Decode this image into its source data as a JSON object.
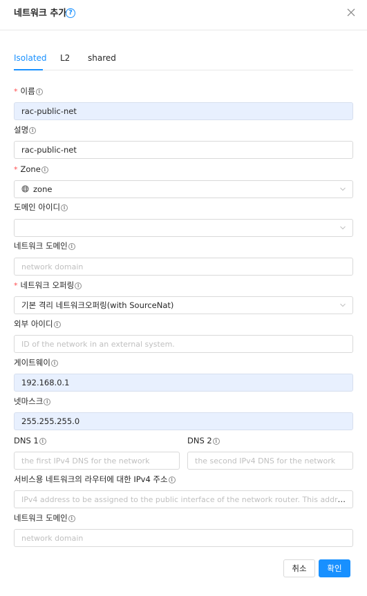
{
  "header": {
    "title": "네트워크 추가",
    "help_glyph": "?",
    "close_icon": "close-icon"
  },
  "tabs": [
    {
      "label": "Isolated",
      "active": true
    },
    {
      "label": "L2",
      "active": false
    },
    {
      "label": "shared",
      "active": false
    }
  ],
  "info_glyph": "i",
  "required_mark": "*",
  "form": {
    "name": {
      "label": "이름",
      "value": "rac-public-net"
    },
    "description": {
      "label": "설명",
      "value": "rac-public-net"
    },
    "zone": {
      "label": "Zone",
      "value": "zone",
      "icon": "globe-icon"
    },
    "domain_id": {
      "label": "도메인 아이디",
      "value": ""
    },
    "network_domain": {
      "label": "네트워크 도메인",
      "placeholder": "network domain"
    },
    "network_offering": {
      "label": "네트워크 오퍼링",
      "value": "기본 격리 네트워크오퍼링(with SourceNat)"
    },
    "external_id": {
      "label": "외부 아이디",
      "placeholder": "ID of the network in an external system."
    },
    "gateway": {
      "label": "게이트웨이",
      "value": "192.168.0.1"
    },
    "netmask": {
      "label": "넷마스크",
      "value": "255.255.255.0"
    },
    "dns1": {
      "label": "DNS 1",
      "placeholder": "the first IPv4 DNS for the network"
    },
    "dns2": {
      "label": "DNS 2",
      "placeholder": "the second IPv4 DNS for the network"
    },
    "router_ipv4": {
      "label": "서비스용 네트워크의 라우터에 대한 IPv4 주소",
      "placeholder": "IPv4 address to be assigned to the public interface of the network router. This address ..."
    },
    "network_domain_2": {
      "label": "네트워크 도메인",
      "placeholder": "network domain"
    }
  },
  "footer": {
    "cancel_label": "취소",
    "ok_label": "확인"
  },
  "colors": {
    "accent": "#1890ff",
    "required": "#ff4d4f",
    "filled_bg": "#e8f0fe",
    "border": "#d9d9d9"
  }
}
